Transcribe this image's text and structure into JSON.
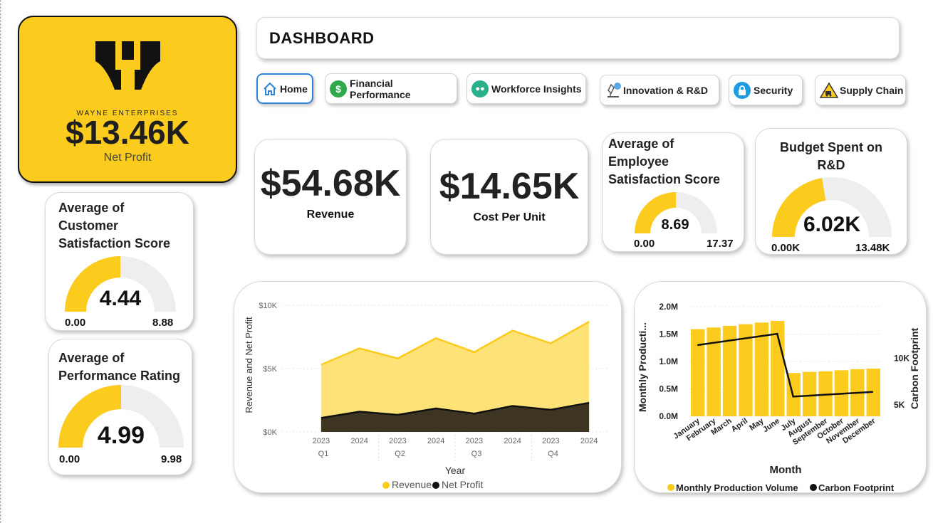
{
  "brand": {
    "company": "WAYNE ENTERPRISES",
    "net_profit_value": "$13.46K",
    "net_profit_label": "Net Profit"
  },
  "header": {
    "title": "DASHBOARD"
  },
  "nav": [
    {
      "label": "Home",
      "icon": "home-icon",
      "active": true
    },
    {
      "label": "Financial Performance",
      "icon": "dollar-icon"
    },
    {
      "label": "Workforce Insights",
      "icon": "people-icon"
    },
    {
      "label": "Innovation & R&D",
      "icon": "microscope-icon"
    },
    {
      "label": "Security",
      "icon": "lock-icon"
    },
    {
      "label": "Supply Chain",
      "icon": "warning-forklift-icon"
    }
  ],
  "kpis": {
    "revenue": {
      "value": "$54.68K",
      "label": "Revenue"
    },
    "cost_per_unit": {
      "value": "$14.65K",
      "label": "Cost Per Unit"
    }
  },
  "gauges": {
    "employee": {
      "title_line1": "Average of",
      "title_line2": "Employee",
      "title_line3": "Satisfaction Score",
      "value": "8.69",
      "min": "0.00",
      "max": "17.37",
      "fraction": 0.5
    },
    "budget": {
      "title_line1": "Budget Spent on",
      "title_line2": "R&D",
      "value": "6.02K",
      "min": "0.00K",
      "max": "13.48K",
      "fraction": 0.447
    },
    "customer": {
      "title_line1": "Average of",
      "title_line2": "Customer",
      "title_line3": "Satisfaction Score",
      "value": "4.44",
      "min": "0.00",
      "max": "8.88",
      "fraction": 0.5
    },
    "performance": {
      "title_line1": "Average of",
      "title_line2": "Performance Rating",
      "value": "4.99",
      "min": "0.00",
      "max": "9.98",
      "fraction": 0.5
    }
  },
  "colors": {
    "accent": "#fbcb1d",
    "dark": "#3d3522",
    "area_light": "#fde278",
    "gauge_bg": "#eeeeee"
  },
  "chart_data": [
    {
      "type": "area",
      "ylabel": "Revenue and Net Profit",
      "xlabel": "Year",
      "y_ticks": [
        "$0K",
        "$5K",
        "$10K"
      ],
      "ylim": [
        0,
        10000
      ],
      "x_years": [
        "2023",
        "2024",
        "2023",
        "2024",
        "2023",
        "2024",
        "2023",
        "2024"
      ],
      "x_quarters": [
        "Q1",
        "Q2",
        "Q3",
        "Q4"
      ],
      "series": [
        {
          "name": "Revenue",
          "values": [
            5300,
            6600,
            5800,
            7400,
            6300,
            8000,
            7000,
            8700
          ]
        },
        {
          "name": "Net Profit",
          "values": [
            1100,
            1600,
            1350,
            1850,
            1450,
            2050,
            1750,
            2300
          ]
        }
      ],
      "legend": "bottom",
      "grid": false
    },
    {
      "type": "bar",
      "xlabel": "Month",
      "ylabel": "Monthly Producti...",
      "ylabel_right": "Carbon Footprint",
      "categories": [
        "January",
        "February",
        "March",
        "April",
        "May",
        "June",
        "July",
        "August",
        "September",
        "October",
        "November",
        "December"
      ],
      "y_ticks": [
        "0.0M",
        "0.5M",
        "1.0M",
        "1.5M",
        "2.0M"
      ],
      "ylim": [
        0,
        2000000
      ],
      "y2_ticks": [
        "5K",
        "10K"
      ],
      "y2lim": [
        3800,
        15500
      ],
      "series": [
        {
          "name": "Monthly Production Volume",
          "type": "bar",
          "values": [
            1590000,
            1620000,
            1650000,
            1680000,
            1710000,
            1740000,
            790000,
            810000,
            820000,
            840000,
            860000,
            870000
          ]
        },
        {
          "name": "Carbon Footprint",
          "type": "line",
          "x_range": [
            "January",
            "December"
          ],
          "values": [
            11400,
            null,
            null,
            null,
            null,
            12600,
            5900,
            null,
            null,
            null,
            null,
            6400
          ]
        }
      ],
      "legend": "bottom"
    }
  ]
}
